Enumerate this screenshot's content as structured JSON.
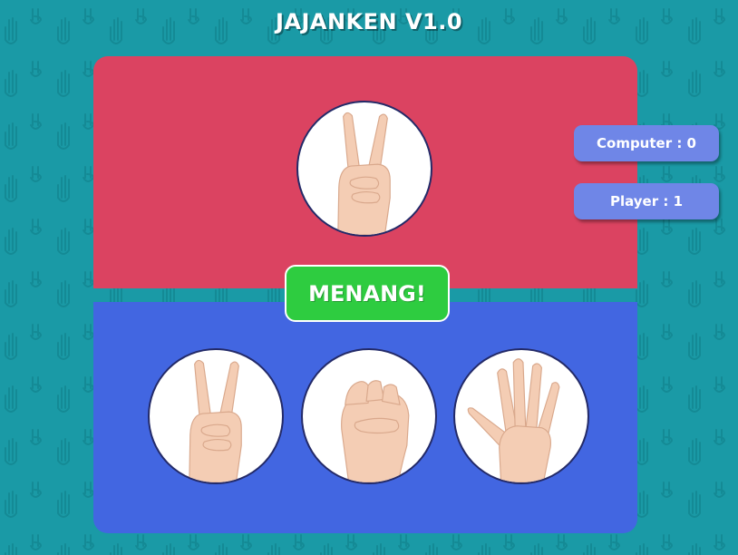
{
  "header": {
    "title": "JAJANKEN V1.0"
  },
  "theme": {
    "background": "#1a9aa6",
    "computer_panel": "#db4361",
    "player_panel": "#4266e1",
    "result_badge": "#2ecc40",
    "score_badge": "#6f86e7"
  },
  "computer": {
    "choice": "scissors-hand-icon"
  },
  "player": {
    "choices": [
      {
        "name": "scissors",
        "icon": "scissors-hand-icon"
      },
      {
        "name": "rock",
        "icon": "rock-fist-icon"
      },
      {
        "name": "paper",
        "icon": "paper-open-hand-icon"
      }
    ]
  },
  "result": {
    "text": "MENANG!"
  },
  "scores": {
    "computer_label": "Computer : 0",
    "player_label": "Player : 1"
  }
}
